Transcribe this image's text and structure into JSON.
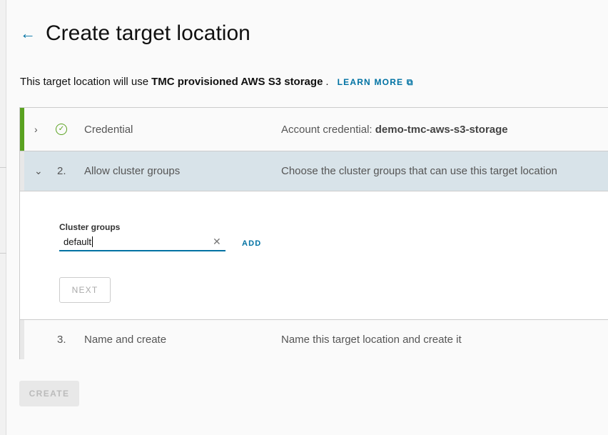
{
  "header": {
    "title": "Create target location",
    "back_icon": "arrow-left-icon"
  },
  "intro": {
    "prefix": "This target location will use",
    "bold": "TMC provisioned AWS S3 storage",
    "suffix": ".",
    "learn_more": "LEARN MORE",
    "learn_more_icon": "external-link-icon"
  },
  "steps": [
    {
      "number": "",
      "label": "Credential",
      "desc_prefix": "Account credential:",
      "desc_bold": "demo-tmc-aws-s3-storage",
      "status": "complete",
      "chevron": "›"
    },
    {
      "number": "2.",
      "label": "Allow cluster groups",
      "desc_prefix": "Choose the cluster groups that can use this target location",
      "chevron": "⌄"
    },
    {
      "number": "3.",
      "label": "Name and create",
      "desc_prefix": "Name this target location and create it"
    }
  ],
  "form": {
    "field_label": "Cluster groups",
    "value": "default",
    "add_label": "ADD",
    "next_label": "NEXT"
  },
  "footer": {
    "create_label": "CREATE"
  },
  "colors": {
    "accent": "#0072a3",
    "success": "#5aa220",
    "active_row": "#d8e3e9"
  }
}
